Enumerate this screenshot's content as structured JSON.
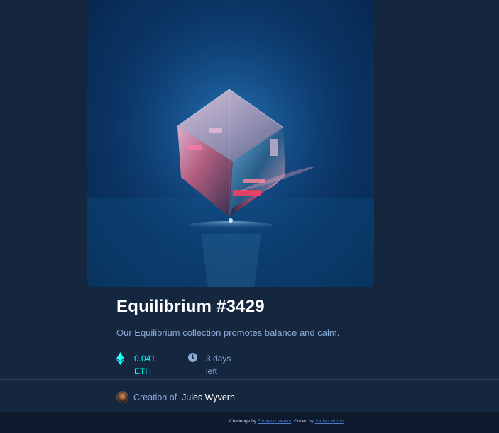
{
  "nft": {
    "image_alt": "Equilibrium",
    "title": "Equilibrium #3429",
    "description": "Our Equilibrium collection promotes balance and calm.",
    "price": {
      "icon": "ethereum-icon",
      "value_line1": "0.041",
      "value_line2": "ETH"
    },
    "time_left": {
      "icon": "clock-icon",
      "line1": "3 days",
      "line2": "left"
    },
    "creator": {
      "label": "Creation of",
      "name": "Jules Wyvern"
    }
  },
  "footer": {
    "prefix": "Challenge by ",
    "challenge_link": "Frontend Mentor",
    "middle": ". Coded by ",
    "author_link": "Jordan Murrin",
    "suffix": "."
  },
  "colors": {
    "background": "#15263f",
    "footer_background": "#0d192c",
    "accent_cyan": "#00fff8",
    "soft_blue": "#8bacd9",
    "white": "#ffffff"
  }
}
